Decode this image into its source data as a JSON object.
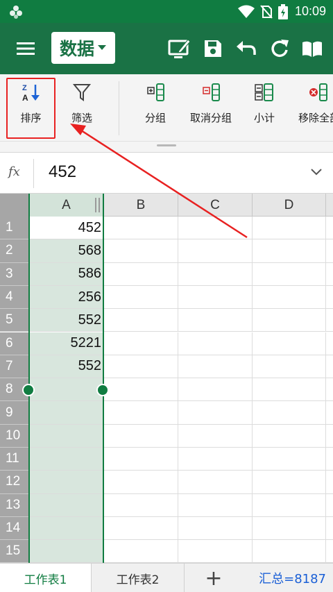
{
  "status_bar": {
    "time": "10:09",
    "icons": [
      "wifi-icon",
      "no-sim-icon",
      "battery-charging-icon"
    ]
  },
  "title_bar": {
    "tab_name": "数据",
    "icons": [
      "menu-icon",
      "edit-sheet-icon",
      "save-icon",
      "undo-icon",
      "redo-icon",
      "reading-view-icon"
    ]
  },
  "ribbon": {
    "items": [
      {
        "label": "排序",
        "icon": "sort-az-icon"
      },
      {
        "label": "筛选",
        "icon": "filter-icon"
      },
      {
        "label": "分组",
        "icon": "group-icon"
      },
      {
        "label": "取消分组",
        "icon": "ungroup-icon"
      },
      {
        "label": "小计",
        "icon": "subtotal-icon"
      },
      {
        "label": "移除全部",
        "icon": "remove-all-icon"
      }
    ]
  },
  "formula_bar": {
    "fx": "fx",
    "value": "452"
  },
  "grid": {
    "columns": [
      "A",
      "B",
      "C",
      "D"
    ],
    "rows": [
      "1",
      "2",
      "3",
      "4",
      "5",
      "6",
      "7",
      "8",
      "9",
      "10",
      "11",
      "12",
      "13",
      "14",
      "15"
    ],
    "column_a_values": [
      "452",
      "568",
      "586",
      "256",
      "552",
      "5221",
      "552"
    ]
  },
  "sheets": {
    "tabs": [
      "工作表1",
      "工作表2"
    ],
    "add": "+",
    "summary": "汇总=8187"
  },
  "colors": {
    "brand_green": "#107c41",
    "highlight_red": "#e82121",
    "summary_blue": "#1a5fd6"
  }
}
